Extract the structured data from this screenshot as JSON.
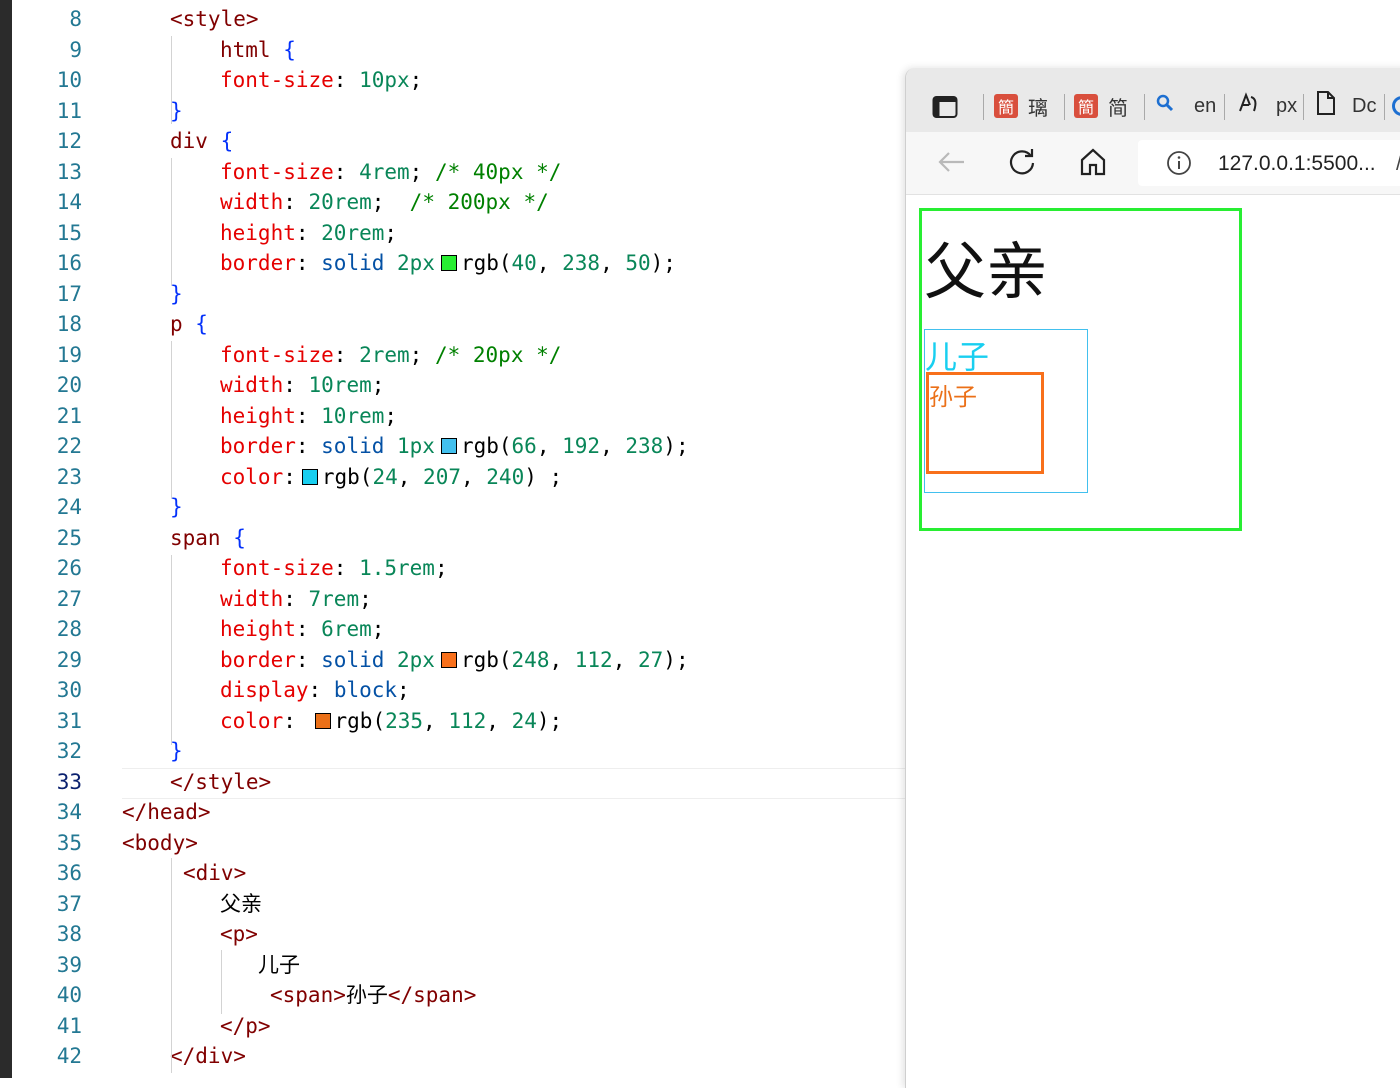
{
  "editor": {
    "active_line": "33",
    "lines": [
      {
        "no": "8",
        "parts": [
          {
            "t": "<style>",
            "c": "tag"
          }
        ]
      },
      {
        "no": "9",
        "parts": [
          {
            "t": "html",
            "c": "sel"
          },
          {
            "t": " {",
            "c": "brace"
          }
        ]
      },
      {
        "no": "10",
        "parts": [
          {
            "t": "font-size",
            "c": "prop"
          },
          {
            "t": ": ",
            "c": "punct"
          },
          {
            "t": "10px",
            "c": "val"
          },
          {
            "t": ";",
            "c": "punct"
          }
        ]
      },
      {
        "no": "11",
        "parts": [
          {
            "t": "}",
            "c": "brace"
          }
        ]
      },
      {
        "no": "12",
        "parts": [
          {
            "t": "div",
            "c": "sel"
          },
          {
            "t": " {",
            "c": "brace"
          }
        ]
      },
      {
        "no": "13",
        "parts": [
          {
            "t": "font-size",
            "c": "prop"
          },
          {
            "t": ": ",
            "c": "punct"
          },
          {
            "t": "4rem",
            "c": "val"
          },
          {
            "t": "; ",
            "c": "punct"
          },
          {
            "t": "/* 40px */",
            "c": "cmt"
          }
        ]
      },
      {
        "no": "14",
        "parts": [
          {
            "t": "width",
            "c": "prop"
          },
          {
            "t": ": ",
            "c": "punct"
          },
          {
            "t": "20rem",
            "c": "val"
          },
          {
            "t": ";  ",
            "c": "punct"
          },
          {
            "t": "/* 200px */",
            "c": "cmt"
          }
        ]
      },
      {
        "no": "15",
        "parts": [
          {
            "t": "height",
            "c": "prop"
          },
          {
            "t": ": ",
            "c": "punct"
          },
          {
            "t": "20rem",
            "c": "val"
          },
          {
            "t": ";",
            "c": "punct"
          }
        ]
      },
      {
        "no": "16",
        "parts": [
          {
            "t": "border",
            "c": "prop"
          },
          {
            "t": ": ",
            "c": "punct"
          },
          {
            "t": "solid ",
            "c": "kw"
          },
          {
            "t": "2px",
            "c": "val"
          },
          {
            "swatch": "#28ee32"
          },
          {
            "t": "rgb(",
            "c": "txt"
          },
          {
            "t": "40",
            "c": "val"
          },
          {
            "t": ", ",
            "c": "punct"
          },
          {
            "t": "238",
            "c": "val"
          },
          {
            "t": ", ",
            "c": "punct"
          },
          {
            "t": "50",
            "c": "val"
          },
          {
            "t": ");",
            "c": "punct"
          }
        ]
      },
      {
        "no": "17",
        "parts": [
          {
            "t": "}",
            "c": "brace"
          }
        ]
      },
      {
        "no": "18",
        "parts": [
          {
            "t": "p",
            "c": "sel"
          },
          {
            "t": " {",
            "c": "brace"
          }
        ]
      },
      {
        "no": "19",
        "parts": [
          {
            "t": "font-size",
            "c": "prop"
          },
          {
            "t": ": ",
            "c": "punct"
          },
          {
            "t": "2rem",
            "c": "val"
          },
          {
            "t": "; ",
            "c": "punct"
          },
          {
            "t": "/* 20px */",
            "c": "cmt"
          }
        ]
      },
      {
        "no": "20",
        "parts": [
          {
            "t": "width",
            "c": "prop"
          },
          {
            "t": ": ",
            "c": "punct"
          },
          {
            "t": "10rem",
            "c": "val"
          },
          {
            "t": ";",
            "c": "punct"
          }
        ]
      },
      {
        "no": "21",
        "parts": [
          {
            "t": "height",
            "c": "prop"
          },
          {
            "t": ": ",
            "c": "punct"
          },
          {
            "t": "10rem",
            "c": "val"
          },
          {
            "t": ";",
            "c": "punct"
          }
        ]
      },
      {
        "no": "22",
        "parts": [
          {
            "t": "border",
            "c": "prop"
          },
          {
            "t": ": ",
            "c": "punct"
          },
          {
            "t": "solid ",
            "c": "kw"
          },
          {
            "t": "1px",
            "c": "val"
          },
          {
            "swatch": "#42c0ee"
          },
          {
            "t": "rgb(",
            "c": "txt"
          },
          {
            "t": "66",
            "c": "val"
          },
          {
            "t": ", ",
            "c": "punct"
          },
          {
            "t": "192",
            "c": "val"
          },
          {
            "t": ", ",
            "c": "punct"
          },
          {
            "t": "238",
            "c": "val"
          },
          {
            "t": ");",
            "c": "punct"
          }
        ]
      },
      {
        "no": "23",
        "parts": [
          {
            "t": "color",
            "c": "prop"
          },
          {
            "t": ":",
            "c": "punct"
          },
          {
            "swatch": "#18cff0"
          },
          {
            "t": "rgb(",
            "c": "txt"
          },
          {
            "t": "24",
            "c": "val"
          },
          {
            "t": ", ",
            "c": "punct"
          },
          {
            "t": "207",
            "c": "val"
          },
          {
            "t": ", ",
            "c": "punct"
          },
          {
            "t": "240",
            "c": "val"
          },
          {
            "t": ") ;",
            "c": "punct"
          }
        ]
      },
      {
        "no": "24",
        "parts": [
          {
            "t": "}",
            "c": "brace"
          }
        ]
      },
      {
        "no": "25",
        "parts": [
          {
            "t": "span",
            "c": "sel"
          },
          {
            "t": " {",
            "c": "brace"
          }
        ]
      },
      {
        "no": "26",
        "parts": [
          {
            "t": "font-size",
            "c": "prop"
          },
          {
            "t": ": ",
            "c": "punct"
          },
          {
            "t": "1.5rem",
            "c": "val"
          },
          {
            "t": ";",
            "c": "punct"
          }
        ]
      },
      {
        "no": "27",
        "parts": [
          {
            "t": "width",
            "c": "prop"
          },
          {
            "t": ": ",
            "c": "punct"
          },
          {
            "t": "7rem",
            "c": "val"
          },
          {
            "t": ";",
            "c": "punct"
          }
        ]
      },
      {
        "no": "28",
        "parts": [
          {
            "t": "height",
            "c": "prop"
          },
          {
            "t": ": ",
            "c": "punct"
          },
          {
            "t": "6rem",
            "c": "val"
          },
          {
            "t": ";",
            "c": "punct"
          }
        ]
      },
      {
        "no": "29",
        "parts": [
          {
            "t": "border",
            "c": "prop"
          },
          {
            "t": ": ",
            "c": "punct"
          },
          {
            "t": "solid ",
            "c": "kw"
          },
          {
            "t": "2px",
            "c": "val"
          },
          {
            "swatch": "#f8701b"
          },
          {
            "t": "rgb(",
            "c": "txt"
          },
          {
            "t": "248",
            "c": "val"
          },
          {
            "t": ", ",
            "c": "punct"
          },
          {
            "t": "112",
            "c": "val"
          },
          {
            "t": ", ",
            "c": "punct"
          },
          {
            "t": "27",
            "c": "val"
          },
          {
            "t": ");",
            "c": "punct"
          }
        ]
      },
      {
        "no": "30",
        "parts": [
          {
            "t": "display",
            "c": "prop"
          },
          {
            "t": ": ",
            "c": "punct"
          },
          {
            "t": "block",
            "c": "kw"
          },
          {
            "t": ";",
            "c": "punct"
          }
        ]
      },
      {
        "no": "31",
        "parts": [
          {
            "t": "color",
            "c": "prop"
          },
          {
            "t": ": ",
            "c": "punct"
          },
          {
            "swatch": "#eb7018"
          },
          {
            "t": "rgb(",
            "c": "txt"
          },
          {
            "t": "235",
            "c": "val"
          },
          {
            "t": ", ",
            "c": "punct"
          },
          {
            "t": "112",
            "c": "val"
          },
          {
            "t": ", ",
            "c": "punct"
          },
          {
            "t": "24",
            "c": "val"
          },
          {
            "t": ");",
            "c": "punct"
          }
        ]
      },
      {
        "no": "32",
        "parts": [
          {
            "t": "}",
            "c": "brace"
          }
        ]
      },
      {
        "no": "33",
        "parts": [
          {
            "t": "</style>",
            "c": "tag"
          }
        ]
      },
      {
        "no": "34",
        "parts": [
          {
            "t": "</head>",
            "c": "tag"
          }
        ]
      },
      {
        "no": "35",
        "parts": [
          {
            "t": "<body>",
            "c": "tag"
          }
        ]
      },
      {
        "no": "36",
        "parts": [
          {
            "t": "<div>",
            "c": "tag"
          }
        ]
      },
      {
        "no": "37",
        "parts": [
          {
            "t": "父亲",
            "c": "txt"
          }
        ]
      },
      {
        "no": "38",
        "parts": [
          {
            "t": "<p>",
            "c": "tag"
          }
        ]
      },
      {
        "no": "39",
        "parts": [
          {
            "t": "儿子",
            "c": "txt"
          }
        ]
      },
      {
        "no": "40",
        "parts": [
          {
            "t": "<span>",
            "c": "tag"
          },
          {
            "t": "孙子",
            "c": "txt"
          },
          {
            "t": "</span>",
            "c": "tag"
          }
        ]
      },
      {
        "no": "41",
        "parts": [
          {
            "t": "</p>",
            "c": "tag"
          }
        ]
      },
      {
        "no": "42",
        "parts": [
          {
            "t": "</div>",
            "c": "tag"
          }
        ]
      }
    ]
  },
  "browser": {
    "tabs": [
      {
        "icon": "red-favicon",
        "icon_text": "簡",
        "label": "璃"
      },
      {
        "icon": "red-favicon",
        "icon_text": "簡",
        "label": "简"
      },
      {
        "icon": "search-icon",
        "label": "en"
      },
      {
        "icon": "translate-icon",
        "label": "px"
      },
      {
        "icon": "page-icon",
        "label": "Dc"
      }
    ],
    "url": "127.0.0.1:5500...",
    "url_suffix": "/",
    "page": {
      "div_text": "父亲",
      "p_text": "儿子",
      "span_text": "孙子",
      "div_border_color": "#28ee32",
      "p_border_color": "#42c0ee",
      "p_text_color": "#18cff0",
      "span_border_color": "#f8701b",
      "span_text_color": "#eb7018"
    }
  }
}
